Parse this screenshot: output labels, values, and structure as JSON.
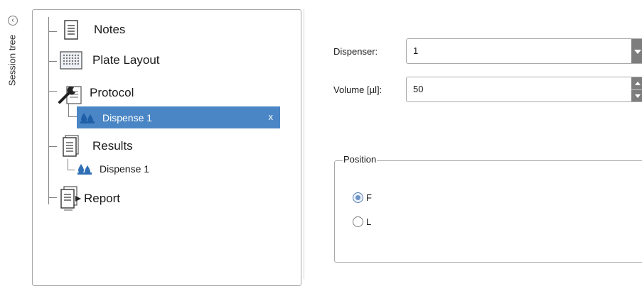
{
  "sidebar": {
    "label": "Session tree"
  },
  "tree": {
    "items": [
      {
        "label": "Notes"
      },
      {
        "label": "Plate Layout"
      },
      {
        "label": "Protocol"
      },
      {
        "label": "Dispense 1",
        "close": "x"
      },
      {
        "label": "Results"
      },
      {
        "label": "Dispense 1"
      },
      {
        "label": "Report"
      }
    ]
  },
  "form": {
    "dispenser_label": "Dispenser:",
    "dispenser_value": "1",
    "volume_label": "Volume [µl]:",
    "volume_value": "50",
    "position": {
      "legend": "Position",
      "options": [
        {
          "label": "F",
          "checked": true
        },
        {
          "label": "L",
          "checked": false
        }
      ]
    }
  },
  "colors": {
    "selection": "#4a86c5",
    "drop_icon": "#2f6fb5"
  }
}
